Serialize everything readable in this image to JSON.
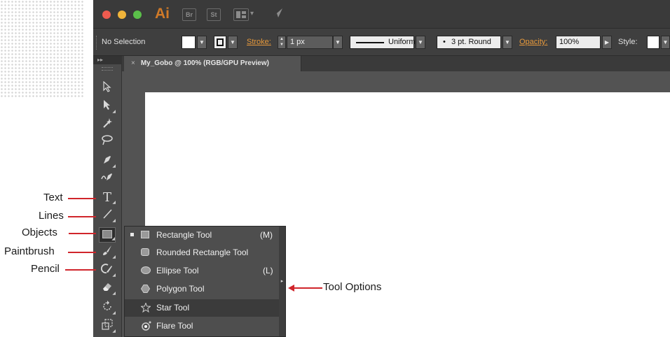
{
  "titlebar": {
    "app_logo": "Ai",
    "bridge_label": "Br",
    "stock_label": "St",
    "colors": {
      "close": "#ee5b4f",
      "minimize": "#f0b43a",
      "zoom": "#5bc04a"
    }
  },
  "control_bar": {
    "selection_label": "No Selection",
    "stroke_label": "Stroke:",
    "stroke_value": "1 px",
    "profile_label": "Uniform",
    "brush_label": "3 pt. Round",
    "opacity_label": "Opacity:",
    "opacity_value": "100%",
    "style_label": "Style:"
  },
  "document_tab": {
    "title": "My_Gobo @ 100% (RGB/GPU Preview)",
    "close_glyph": "×"
  },
  "toolbox": {
    "tools": [
      "selection-tool",
      "direct-selection-tool",
      "magic-wand-tool",
      "lasso-tool",
      "pen-tool",
      "curvature-tool",
      "type-tool",
      "line-segment-tool",
      "rectangle-tool",
      "paintbrush-tool",
      "shaper-tool",
      "eraser-tool",
      "rotate-tool",
      "scale-tool"
    ],
    "type_glyph": "T"
  },
  "flyout": {
    "items": [
      {
        "label": "Rectangle Tool",
        "shortcut": "(M)",
        "icon": "rectangle-icon",
        "active": true
      },
      {
        "label": "Rounded Rectangle Tool",
        "shortcut": "",
        "icon": "rounded-rectangle-icon",
        "active": false
      },
      {
        "label": "Ellipse Tool",
        "shortcut": "(L)",
        "icon": "ellipse-icon",
        "active": false
      },
      {
        "label": "Polygon Tool",
        "shortcut": "",
        "icon": "polygon-icon",
        "active": false
      },
      {
        "label": "Star Tool",
        "shortcut": "",
        "icon": "star-icon",
        "active": false
      },
      {
        "label": "Flare Tool",
        "shortcut": "",
        "icon": "flare-icon",
        "active": false
      }
    ]
  },
  "annotations": {
    "text": "Text",
    "lines": "Lines",
    "objects": "Objects",
    "paintbrush": "Paintbrush",
    "pencil": "Pencil",
    "tool_options": "Tool Options",
    "color": "#d0252b"
  }
}
